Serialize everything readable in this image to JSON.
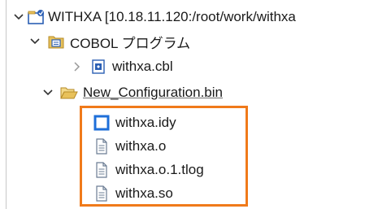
{
  "tree": {
    "project": {
      "label": "WITHXA [10.18.11.120:/root/work/withxa",
      "icon": "project-icon",
      "expanded": true
    },
    "cobol_folder": {
      "label": "COBOL プログラム",
      "icon": "cobol-folder-icon",
      "expanded": true
    },
    "cbl_file": {
      "label": "withxa.cbl",
      "icon": "cobol-file-icon",
      "expanded": false
    },
    "config_folder": {
      "label": "New_Configuration.bin",
      "icon": "open-folder-icon",
      "expanded": true
    },
    "build_outputs": [
      {
        "label": "withxa.idy",
        "icon": "blue-square-icon"
      },
      {
        "label": "withxa.o",
        "icon": "text-file-icon"
      },
      {
        "label": "withxa.o.1.tlog",
        "icon": "text-file-icon"
      },
      {
        "label": "withxa.so",
        "icon": "text-file-icon"
      }
    ]
  },
  "colors": {
    "highlight_border": "#f07a1a",
    "chevron": "#333333",
    "folder_yellow": "#e8c15a",
    "project_blue": "#2b5fb4"
  }
}
